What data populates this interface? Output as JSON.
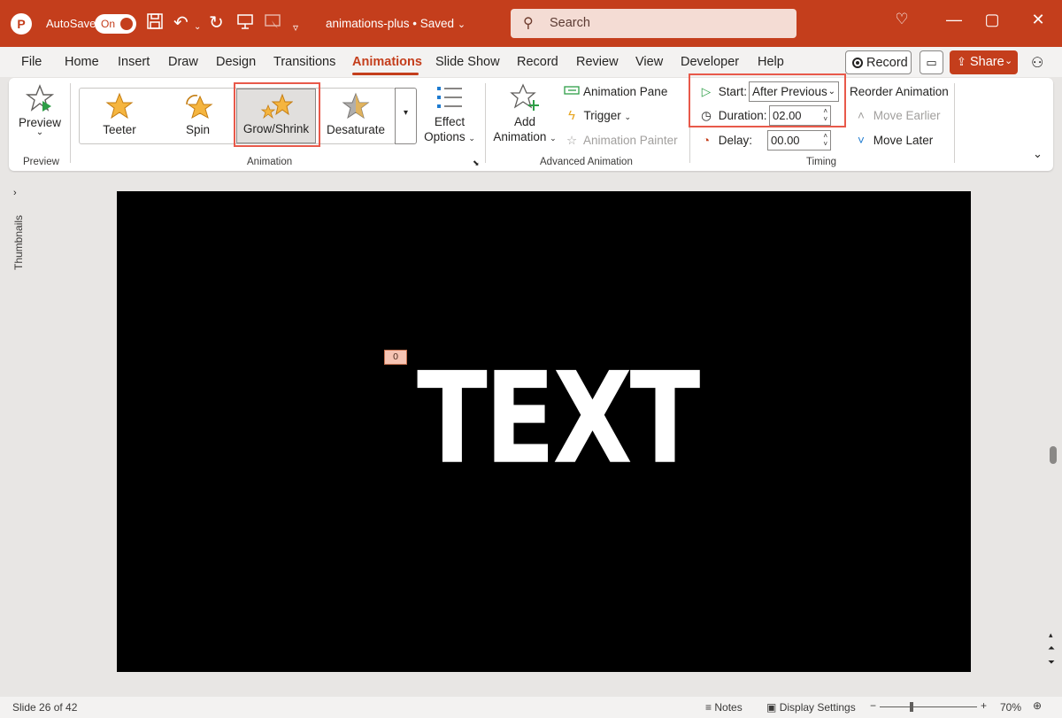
{
  "titlebar": {
    "autosave_label": "AutoSave",
    "autosave_state": "On",
    "document_title": "animations-plus • Saved",
    "search_placeholder": "Search",
    "accent_color": "#c43e1c"
  },
  "menu": {
    "tabs": [
      "File",
      "Home",
      "Insert",
      "Draw",
      "Design",
      "Transitions",
      "Animations",
      "Slide Show",
      "Record",
      "Review",
      "View",
      "Developer",
      "Help"
    ],
    "active_tab": "Animations",
    "record_label": "Record",
    "share_label": "Share"
  },
  "ribbon": {
    "preview": {
      "label": "Preview",
      "group": "Preview"
    },
    "animation_gallery": {
      "items": [
        "Teeter",
        "Spin",
        "Grow/Shrink",
        "Desaturate"
      ],
      "selected": "Grow/Shrink"
    },
    "effect_options": {
      "line1": "Effect",
      "line2": "Options"
    },
    "animation_group": "Animation",
    "add_animation": {
      "line1": "Add",
      "line2": "Animation"
    },
    "animation_pane": "Animation Pane",
    "trigger": "Trigger",
    "animation_painter": "Animation Painter",
    "advanced_group": "Advanced Animation",
    "timing": {
      "start_label": "Start:",
      "start_value": "After Previous",
      "duration_label": "Duration:",
      "duration_value": "02.00",
      "delay_label": "Delay:",
      "delay_value": "00.00",
      "group": "Timing"
    },
    "reorder": {
      "title": "Reorder Animation",
      "move_earlier": "Move Earlier",
      "move_later": "Move Later"
    }
  },
  "left_rail": {
    "thumbnails_label": "Thumbnails"
  },
  "slide": {
    "text": "TEXT",
    "animation_tag": "0"
  },
  "statusbar": {
    "slide_info": "Slide 26 of 42",
    "notes": "Notes",
    "display_settings": "Display Settings",
    "zoom": "70%"
  }
}
